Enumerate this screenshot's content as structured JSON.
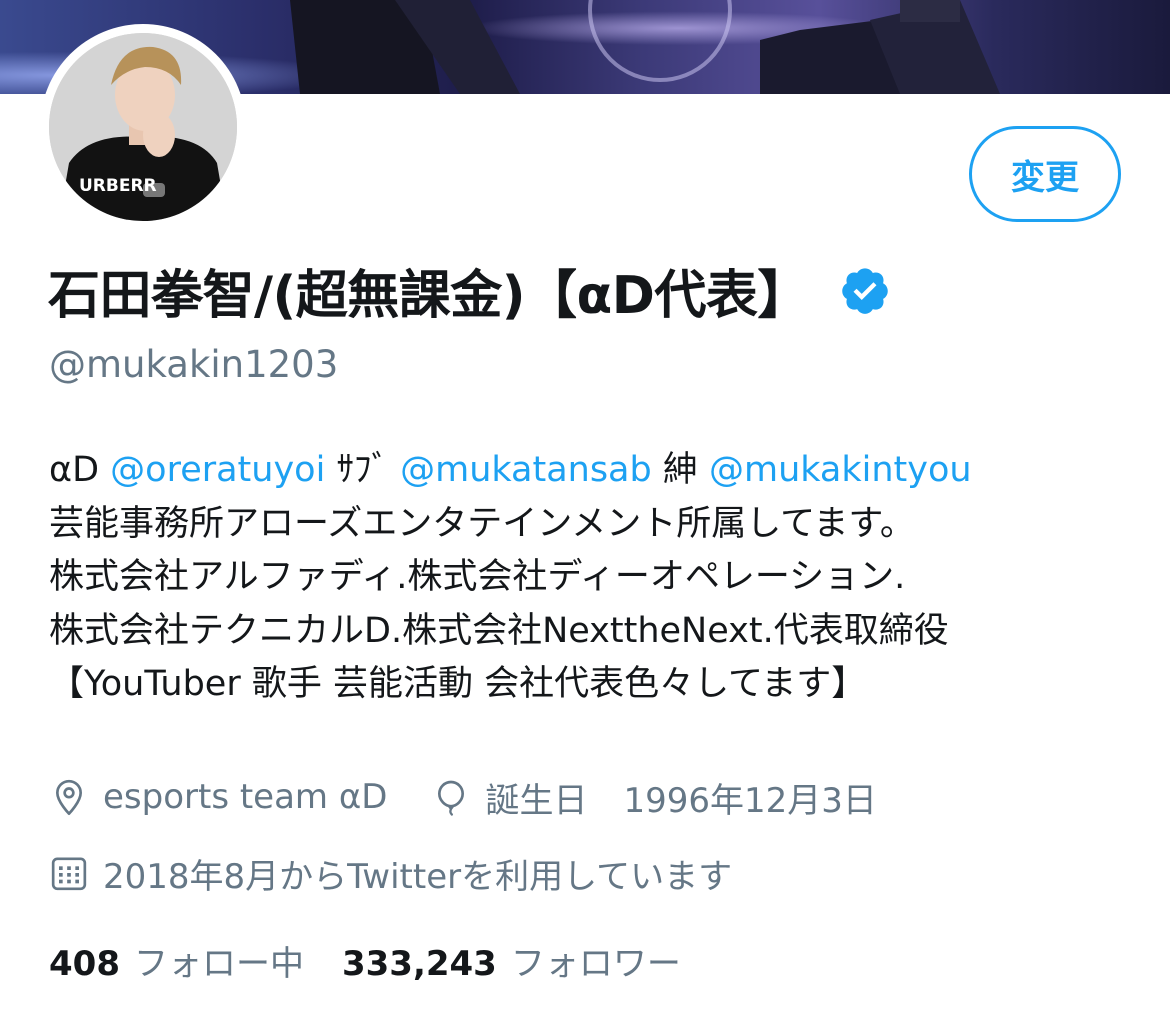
{
  "header": {
    "edit_button_label": "変更"
  },
  "profile": {
    "display_name": "石田拳智/(超無課金)【αD代表】",
    "handle": "@mukakin1203",
    "verified": true
  },
  "bio": {
    "line1": {
      "t1": "αD ",
      "m1": "@oreratuyoi",
      "t2": " ｻﾌﾞ ",
      "m2": "@mukatansab",
      "t3": " 紳 ",
      "m3": "@mukakintyou"
    },
    "line2": "芸能事務所アローズエンタテインメント所属してます。",
    "line3": "株式会社アルファディ.株式会社ディーオペレーション.",
    "line4": "株式会社テクニカルD.株式会社NexttheNext.代表取締役",
    "line5": "【YouTuber 歌手 芸能活動 会社代表色々してます】"
  },
  "meta": {
    "location": "esports team αD",
    "birthday_label": "誕生日",
    "birthday_value": "1996年12月3日",
    "joined": "2018年8月からTwitterを利用しています"
  },
  "stats": {
    "following_count": "408",
    "following_label": "フォロー中",
    "followers_count": "333,243",
    "followers_label": "フォロワー"
  },
  "colors": {
    "accent": "#1da1f2",
    "secondary_text": "#657786",
    "primary_text": "#14171a"
  },
  "icons": {
    "location": "map-pin-icon",
    "birthday": "balloon-icon",
    "joined": "calendar-icon",
    "verified": "verified-badge-icon"
  }
}
